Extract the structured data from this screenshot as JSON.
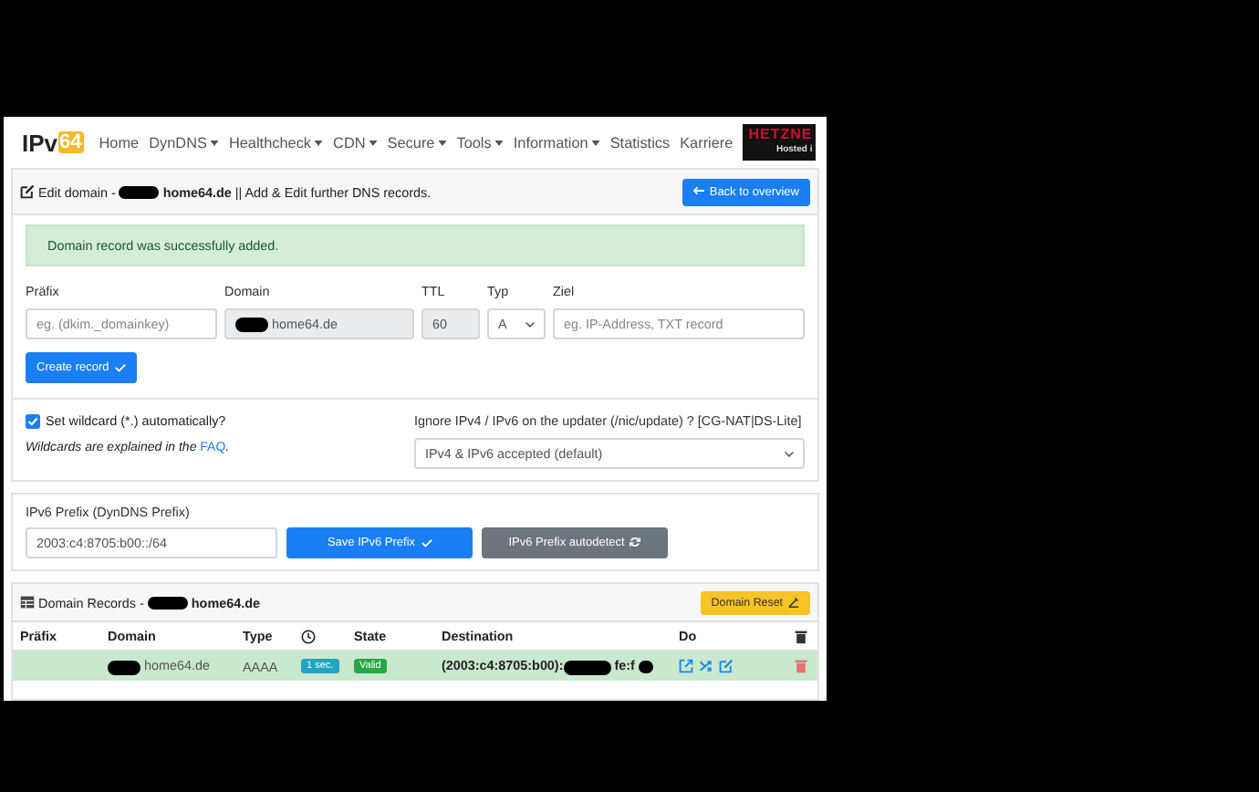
{
  "logo": {
    "text": "IPv",
    "badge": "64"
  },
  "nav": [
    {
      "label": "Home",
      "dropdown": false
    },
    {
      "label": "DynDNS",
      "dropdown": true
    },
    {
      "label": "Healthcheck",
      "dropdown": true
    },
    {
      "label": "CDN",
      "dropdown": true
    },
    {
      "label": "Secure",
      "dropdown": true
    },
    {
      "label": "Tools",
      "dropdown": true
    },
    {
      "label": "Information",
      "dropdown": true
    },
    {
      "label": "Statistics",
      "dropdown": false
    },
    {
      "label": "Karriere",
      "dropdown": false
    }
  ],
  "sponsor": {
    "name": "HETZNE",
    "tagline": "Hosted i"
  },
  "header": {
    "prefix": "Edit domain -",
    "redacted": true,
    "domain": "home64.de",
    "suffix": "|| Add & Edit further DNS records.",
    "button": "Back to overview"
  },
  "alert": "Domain record was successfully added.",
  "record_form": {
    "fields": [
      {
        "label": "Präfix",
        "kind": "input",
        "placeholder": "eg. (dkim._domainkey)"
      },
      {
        "label": "Domain",
        "kind": "readonly",
        "value": "home64.de",
        "redacted": true
      },
      {
        "label": "TTL",
        "kind": "readonly",
        "value": "60"
      },
      {
        "label": "Typ",
        "kind": "select",
        "value": "A"
      },
      {
        "label": "Ziel",
        "kind": "input",
        "placeholder": "eg. IP-Address, TXT record"
      }
    ],
    "button": "Create record"
  },
  "wildcard": {
    "label": "Set wildcard (*.) automatically?",
    "checked": true,
    "hint": "Wildcards are explained in the",
    "link": "FAQ",
    "hint_end": "."
  },
  "ignore": {
    "label": "Ignore IPv4 / IPv6 on the updater (/nic/update) ? [CG-NAT|DS-Lite]",
    "value": "IPv4 & IPv6 accepted (default)"
  },
  "prefix": {
    "label": "IPv6 Prefix (DynDNS Prefix)",
    "value": "2003:c4:8705:b00::/64",
    "save": "Save IPv6 Prefix",
    "detect": "IPv6 Prefix autodetect"
  },
  "records": {
    "title": "Domain Records -",
    "redacted": true,
    "domain": "home64.de",
    "reset": "Domain Reset",
    "columns": [
      {
        "kind": "text",
        "label": "Präfix"
      },
      {
        "kind": "text",
        "label": "Domain"
      },
      {
        "kind": "text",
        "label": "Type"
      },
      {
        "kind": "clock"
      },
      {
        "kind": "text",
        "label": "State"
      },
      {
        "kind": "text",
        "label": "Destination"
      },
      {
        "kind": "text",
        "label": "Do"
      },
      {
        "kind": "trash"
      }
    ],
    "rows": [
      {
        "domain": "home64.de",
        "redacted": true,
        "type": "AAAA",
        "ttl": "1 sec.",
        "state": "Valid",
        "destination": "(2003:c4:8705:b00):",
        "destination_tail": "fe:f"
      }
    ]
  }
}
